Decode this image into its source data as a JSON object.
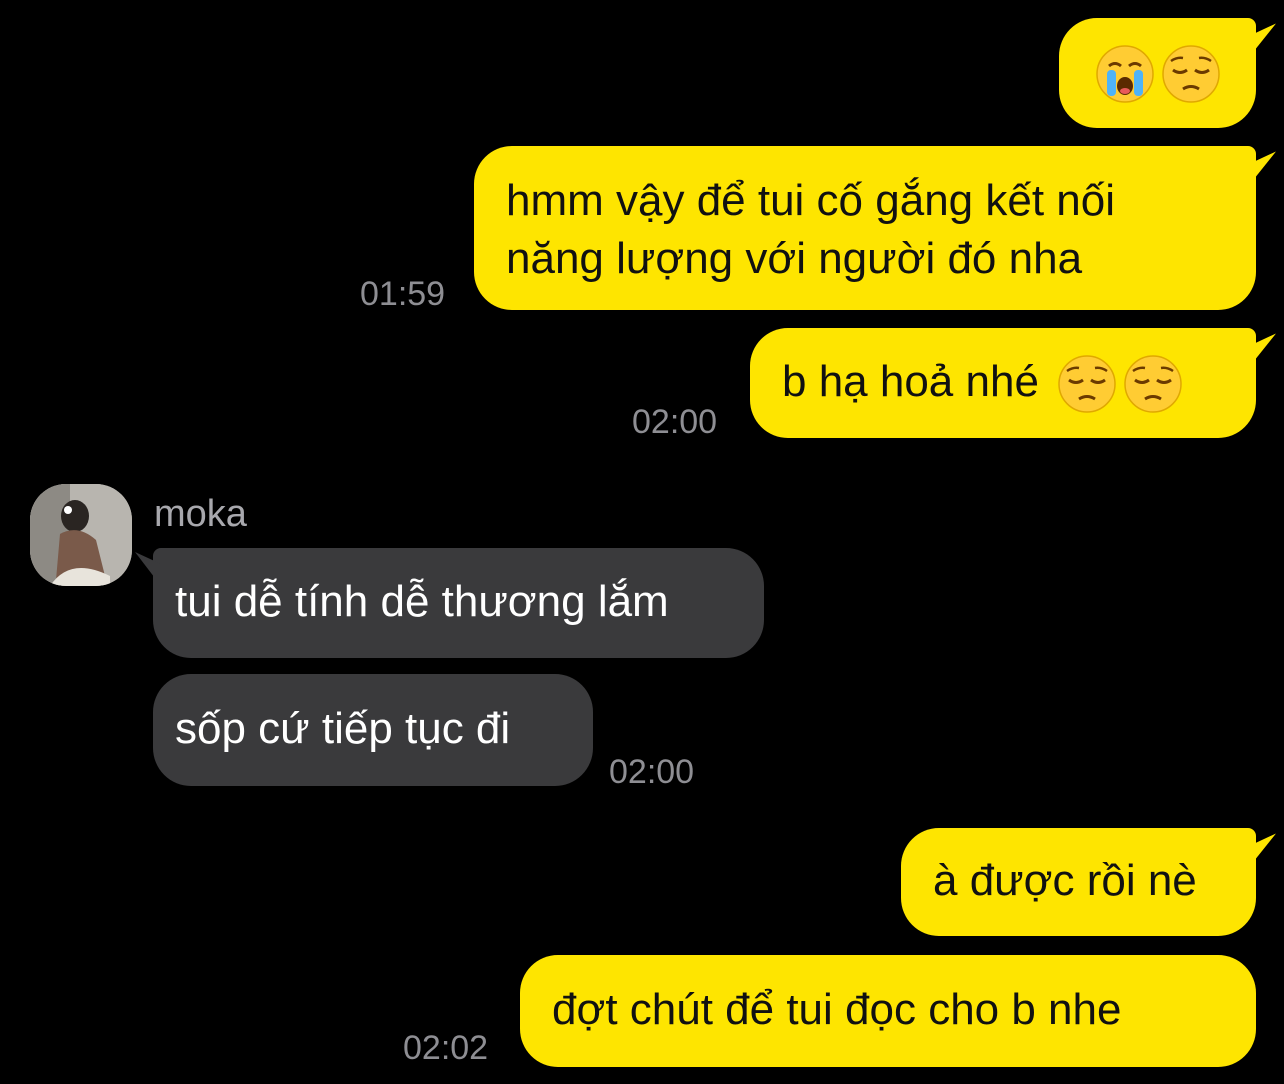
{
  "messages": [
    {
      "id": "m1",
      "dir": "out",
      "text": "",
      "emoji": [
        "loudly-crying-face",
        "pensive-face"
      ]
    },
    {
      "id": "m2",
      "dir": "out",
      "lines": [
        "hmm vậy để tui cố gắng kết nối",
        "năng lượng với người đó nha"
      ],
      "time": "01:59"
    },
    {
      "id": "m3",
      "dir": "out",
      "text": "b hạ hoả nhé",
      "emoji": [
        "pensive-face",
        "pensive-face"
      ],
      "time": "02:00"
    },
    {
      "id": "m4",
      "dir": "in",
      "sender": "moka",
      "text": "tui dễ tính dễ thương lắm"
    },
    {
      "id": "m5",
      "dir": "in",
      "text": "sốp cứ tiếp tục đi",
      "time": "02:00"
    },
    {
      "id": "m6",
      "dir": "out",
      "text": "à được rồi nè"
    },
    {
      "id": "m7",
      "dir": "out",
      "text": "đợt chút để tui đọc cho b nhe",
      "time": "02:02"
    }
  ],
  "colors": {
    "outgoing": "#FEE500",
    "incoming": "#3A3A3C",
    "background": "#000000",
    "timestamp": "#8E8E93"
  }
}
